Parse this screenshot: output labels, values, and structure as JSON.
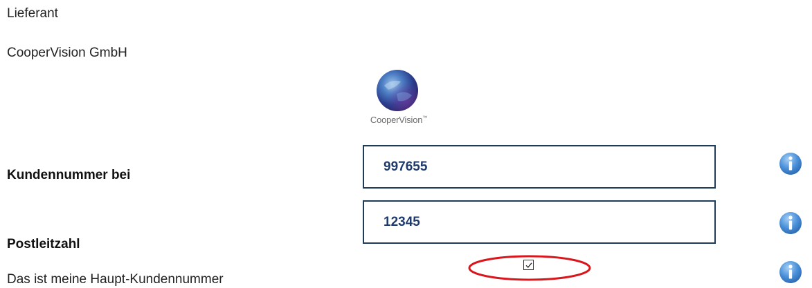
{
  "supplier": {
    "heading": "Lieferant",
    "name": "CooperVision GmbH",
    "logo_text": "CooperVision",
    "logo_mark": "™"
  },
  "form": {
    "customer_number": {
      "label": "Kundennummer bei",
      "value": "997655"
    },
    "postal_code": {
      "label": "Postleitzahl",
      "value": "12345"
    },
    "main_customer_number": {
      "label": "Das ist meine Haupt-Kundennummer",
      "checked": true
    }
  },
  "icons": {
    "info": "info-icon",
    "logo": "globe-logo"
  },
  "colors": {
    "field_border": "#1f3b5a",
    "field_text": "#1f3b6e",
    "info_icon": "#4a90d9",
    "highlight_ellipse": "#d9161c"
  }
}
